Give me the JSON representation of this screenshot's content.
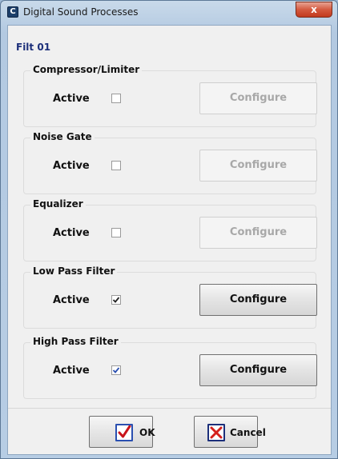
{
  "window": {
    "title": "Digital Sound Processes",
    "app_icon_letter": "C",
    "close_glyph": "x"
  },
  "filter_name": "Filt 01",
  "groups": [
    {
      "title": "Compressor/Limiter",
      "active_label": "Active",
      "checked": false,
      "configure_label": "Configure",
      "configure_enabled": false
    },
    {
      "title": "Noise Gate",
      "active_label": "Active",
      "checked": false,
      "configure_label": "Configure",
      "configure_enabled": false
    },
    {
      "title": "Equalizer",
      "active_label": "Active",
      "checked": false,
      "configure_label": "Configure",
      "configure_enabled": false
    },
    {
      "title": "Low Pass Filter",
      "active_label": "Active",
      "checked": true,
      "configure_label": "Configure",
      "configure_enabled": true
    },
    {
      "title": "High Pass Filter",
      "active_label": "Active",
      "checked": true,
      "configure_label": "Configure",
      "configure_enabled": true
    }
  ],
  "buttons": {
    "ok_label": "OK",
    "cancel_label": "Cancel"
  },
  "colors": {
    "accent_blue": "#2a4fb0",
    "cancel_red": "#d4201c",
    "ok_check_red": "#c8141c"
  }
}
